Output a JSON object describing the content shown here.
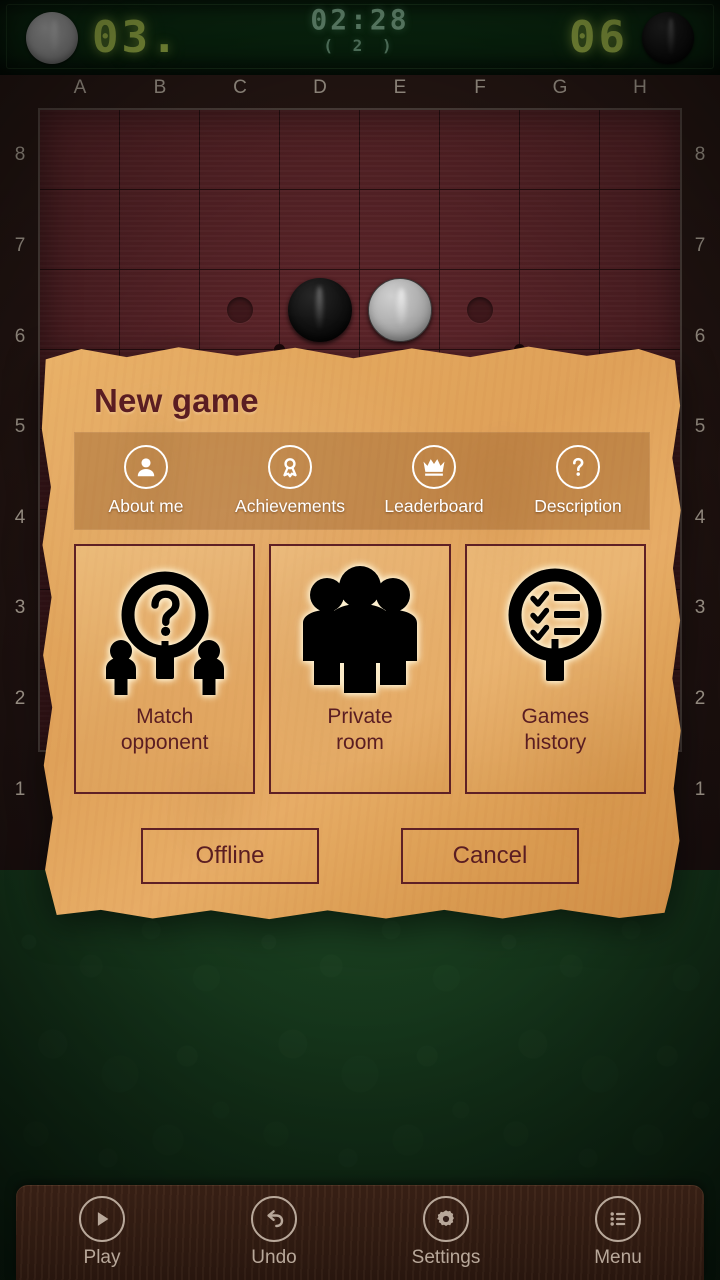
{
  "scoreboard": {
    "left_piece_color": "white",
    "left_score": "03.",
    "timer": "02:28",
    "timer_sub": "( 2 )",
    "right_score": "06",
    "right_piece_color": "black",
    "led_score_color": "#a9c44e",
    "led_timer_color": "#7fae8e"
  },
  "board": {
    "files": [
      "A",
      "B",
      "C",
      "D",
      "E",
      "F",
      "G",
      "H"
    ],
    "ranks": [
      "8",
      "7",
      "6",
      "5",
      "4",
      "3",
      "2",
      "1"
    ],
    "pieces": [
      {
        "square": "D6",
        "color": "black"
      },
      {
        "square": "E6",
        "color": "white"
      }
    ],
    "hints": [
      "C6",
      "F6"
    ],
    "board_color": "#5a2328",
    "label_color": "#bdb2a4"
  },
  "dialog": {
    "title": "New game",
    "accent_color": "#5a1d22",
    "parchment_color": "#e3a75e",
    "icon_strip": [
      {
        "label": "About me",
        "icon": "person-icon"
      },
      {
        "label": "Achievements",
        "icon": "award-medal-icon"
      },
      {
        "label": "Leaderboard",
        "icon": "crown-icon"
      },
      {
        "label": "Description",
        "icon": "question-mark-icon"
      }
    ],
    "cards": [
      {
        "label_line1": "Match",
        "label_line2": "opponent",
        "icon": "magnifier-question-people-icon"
      },
      {
        "label_line1": "Private",
        "label_line2": "room",
        "icon": "group-people-icon"
      },
      {
        "label_line1": "Games",
        "label_line2": "history",
        "icon": "magnifier-checklist-icon"
      }
    ],
    "buttons": [
      {
        "label": "Offline"
      },
      {
        "label": "Cancel"
      }
    ]
  },
  "toolbar": {
    "items": [
      {
        "label": "Play",
        "icon": "play-icon"
      },
      {
        "label": "Undo",
        "icon": "undo-arrow-icon"
      },
      {
        "label": "Settings",
        "icon": "gear-icon"
      },
      {
        "label": "Menu",
        "icon": "list-menu-icon"
      }
    ],
    "label_color": "#b8a89a"
  }
}
